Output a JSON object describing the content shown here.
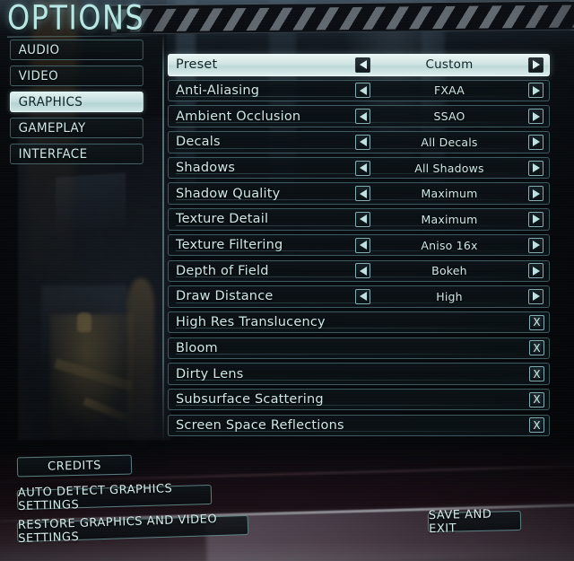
{
  "header": {
    "title": "OPTIONS"
  },
  "sidebar": {
    "items": [
      {
        "label": "AUDIO",
        "selected": false
      },
      {
        "label": "VIDEO",
        "selected": false
      },
      {
        "label": "GRAPHICS",
        "selected": true
      },
      {
        "label": "GAMEPLAY",
        "selected": false
      },
      {
        "label": "INTERFACE",
        "selected": false
      }
    ]
  },
  "options": {
    "rows": [
      {
        "label": "Preset",
        "type": "selector",
        "value": "Custom",
        "selected": true
      },
      {
        "label": "Anti-Aliasing",
        "type": "selector",
        "value": "FXAA",
        "selected": false
      },
      {
        "label": "Ambient Occlusion",
        "type": "selector",
        "value": "SSAO",
        "selected": false
      },
      {
        "label": "Decals",
        "type": "selector",
        "value": "All Decals",
        "selected": false
      },
      {
        "label": "Shadows",
        "type": "selector",
        "value": "All Shadows",
        "selected": false
      },
      {
        "label": "Shadow Quality",
        "type": "selector",
        "value": "Maximum",
        "selected": false
      },
      {
        "label": "Texture Detail",
        "type": "selector",
        "value": "Maximum",
        "selected": false
      },
      {
        "label": "Texture Filtering",
        "type": "selector",
        "value": "Aniso 16x",
        "selected": false
      },
      {
        "label": "Depth of Field",
        "type": "selector",
        "value": "Bokeh",
        "selected": false
      },
      {
        "label": "Draw Distance",
        "type": "selector",
        "value": "High",
        "selected": false
      },
      {
        "label": "High Res Translucency",
        "type": "checkbox",
        "checked": true,
        "mark": "X",
        "selected": false
      },
      {
        "label": "Bloom",
        "type": "checkbox",
        "checked": true,
        "mark": "X",
        "selected": false
      },
      {
        "label": "Dirty Lens",
        "type": "checkbox",
        "checked": true,
        "mark": "X",
        "selected": false
      },
      {
        "label": "Subsurface Scattering",
        "type": "checkbox",
        "checked": true,
        "mark": "X",
        "selected": false
      },
      {
        "label": "Screen Space Reflections",
        "type": "checkbox",
        "checked": true,
        "mark": "X",
        "selected": false
      }
    ],
    "arrow_left_icon": "left-arrow-icon",
    "arrow_right_icon": "right-arrow-icon"
  },
  "buttons": {
    "credits": "CREDITS",
    "auto_detect": "AUTO DETECT GRAPHICS SETTINGS",
    "restore": "RESTORE GRAPHICS AND VIDEO SETTINGS",
    "save_and_exit": "SAVE AND EXIT"
  },
  "colors": {
    "accent_text": "#cfe6e6",
    "selected_bg": "#cfe4e3",
    "selected_text": "#0d2326",
    "border": "#6ea0a5",
    "title": "#b9e7e4"
  }
}
